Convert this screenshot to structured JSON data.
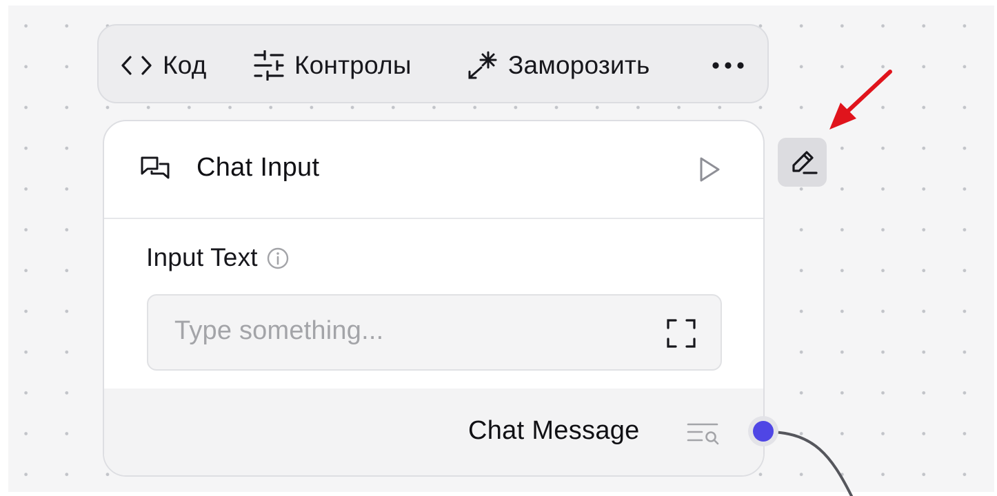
{
  "toolbar": {
    "code_label": "Код",
    "controls_label": "Контролы",
    "freeze_label": "Заморозить",
    "more_icon": "more-horizontal-icon"
  },
  "node": {
    "title": "Chat Input",
    "icon": "chat-bubbles-icon",
    "run_icon": "play-icon",
    "field": {
      "label": "Input Text",
      "info_icon": "info-icon",
      "placeholder": "Type something...",
      "value": "",
      "expand_icon": "expand-icon"
    },
    "output": {
      "label": "Chat Message",
      "inspect_icon": "list-search-icon",
      "handle_color": "#4f46e5"
    }
  },
  "edit_button": {
    "icon": "pencil-icon"
  },
  "annotation": {
    "arrow_color": "#e0141c"
  },
  "colors": {
    "canvas_background": "#f5f5f6",
    "toolbar_background": "#ededef",
    "accent": "#4f46e5"
  }
}
